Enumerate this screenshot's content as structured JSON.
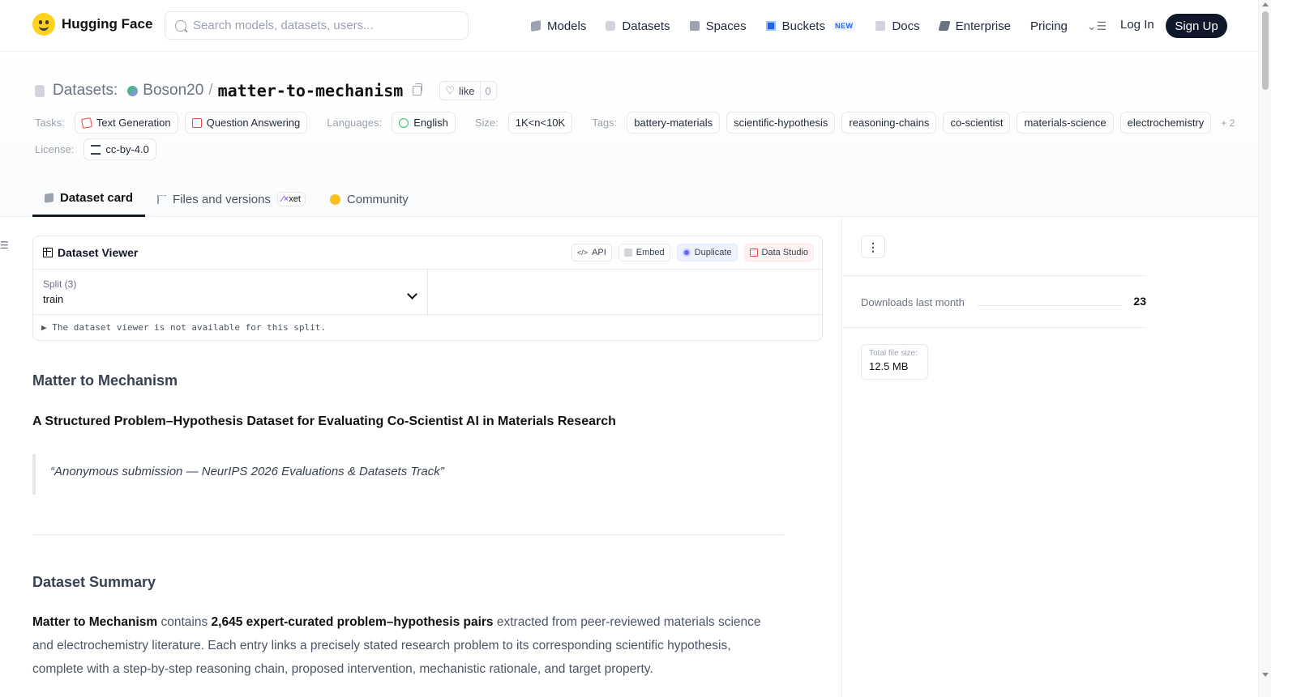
{
  "nav": {
    "brand": "Hugging Face",
    "search_placeholder": "Search models, datasets, users...",
    "links": [
      {
        "label": "Models",
        "icon": "cube-icon"
      },
      {
        "label": "Datasets",
        "icon": "database-icon"
      },
      {
        "label": "Spaces",
        "icon": "grid-icon"
      },
      {
        "label": "Buckets",
        "icon": "bucket-icon",
        "badge": "NEW"
      },
      {
        "label": "Docs",
        "icon": "book-icon"
      },
      {
        "label": "Enterprise",
        "icon": "enterprise-icon"
      },
      {
        "label": "Pricing"
      }
    ],
    "more_menu": "⌄☰",
    "login": "Log In",
    "signup": "Sign Up"
  },
  "header": {
    "prefix": "Datasets:",
    "owner": "Boson20",
    "separator": "/",
    "repo": "matter-to-mechanism",
    "like_label": "like",
    "like_count": "0",
    "tasks_label": "Tasks:",
    "tasks": [
      "Text Generation",
      "Question Answering"
    ],
    "languages_label": "Languages:",
    "languages": [
      "English"
    ],
    "size_label": "Size:",
    "size": "1K<n<10K",
    "tags_label": "Tags:",
    "tags": [
      "battery-materials",
      "scientific-hypothesis",
      "reasoning-chains",
      "co-scientist",
      "materials-science",
      "electrochemistry"
    ],
    "more_tags": "+ 2",
    "license_label": "License:",
    "license": "cc-by-4.0"
  },
  "tabs": [
    {
      "label": "Dataset card",
      "active": true
    },
    {
      "label": "Files and versions",
      "badge": "xet"
    },
    {
      "label": "Community"
    }
  ],
  "viewer": {
    "title": "Dataset Viewer",
    "buttons": [
      "API",
      "Embed",
      "Duplicate",
      "Data Studio"
    ],
    "split_label": "Split (3)",
    "split_value": "train",
    "note": "▶ The dataset viewer is not available for this split."
  },
  "card": {
    "h1": "Matter to Mechanism",
    "subtitle": "A Structured Problem–Hypothesis Dataset for Evaluating Co-Scientist AI in Materials Research",
    "quote": "“Anonymous submission — NeurIPS 2026 Evaluations & Datasets Track”",
    "summary_heading": "Dataset Summary",
    "summary_bold1": "Matter to Mechanism",
    "summary_text1": " contains ",
    "summary_bold2": "2,645 expert-curated problem–hypothesis pairs",
    "summary_text2": " extracted from peer-reviewed materials science and electrochemistry literature. Each entry links a precisely stated research problem to its corresponding scientific hypothesis, complete with a step-by-step reasoning chain, proposed intervention, mechanistic rationale, and target property."
  },
  "sidebar": {
    "menu_icon": "⋮",
    "downloads_label": "Downloads last month",
    "downloads_value": "23",
    "size_label": "Total file size:",
    "size_value": "12.5 MB"
  }
}
